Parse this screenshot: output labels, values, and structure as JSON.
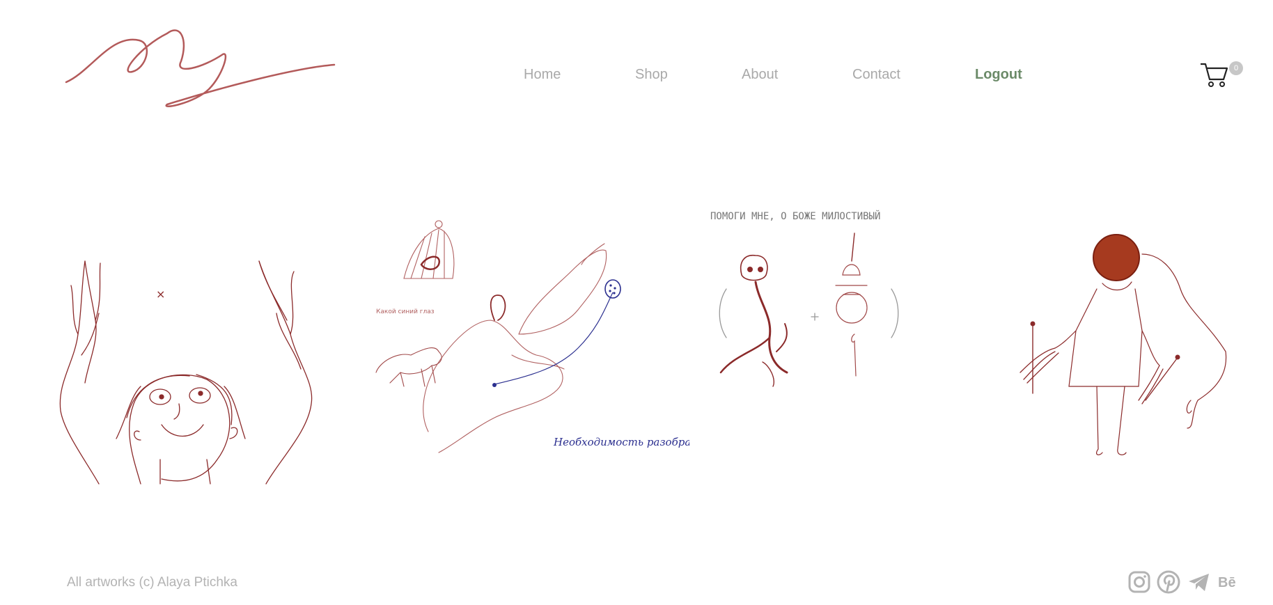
{
  "nav": {
    "items": [
      {
        "label": "Home",
        "active": false
      },
      {
        "label": "Shop",
        "active": false
      },
      {
        "label": "About",
        "active": false
      },
      {
        "label": "Contact",
        "active": false
      },
      {
        "label": "Logout",
        "active": true
      }
    ]
  },
  "cart": {
    "count": "0",
    "icon": "cart-icon"
  },
  "gallery": [
    {
      "name": "artwork-figure-arms-raised",
      "texts": [
        "×"
      ]
    },
    {
      "name": "artwork-birdcage-animals",
      "texts": [
        "Необходимость разобраться.",
        "Какой синий глаз"
      ]
    },
    {
      "name": "artwork-skull-prayer",
      "texts": [
        "ПОМОГИ МНЕ, О БОЖЕ МИЛОСТИВЫЙ"
      ]
    },
    {
      "name": "artwork-girl-in-dress",
      "texts": []
    }
  ],
  "footer": {
    "copyright": "All artworks (c) Alaya Ptichka",
    "social": [
      {
        "icon": "instagram-icon"
      },
      {
        "icon": "pinterest-icon"
      },
      {
        "icon": "telegram-icon"
      },
      {
        "icon": "behance-icon",
        "label": "Bē"
      }
    ]
  },
  "colors": {
    "accent": "#6b8a68",
    "nav_text": "#a9a9a9",
    "footer_text": "#b3b3b3",
    "ink_red": "#8b2a2a",
    "ink_blue": "#2b2f8f",
    "badge": "#c7c7c7"
  }
}
